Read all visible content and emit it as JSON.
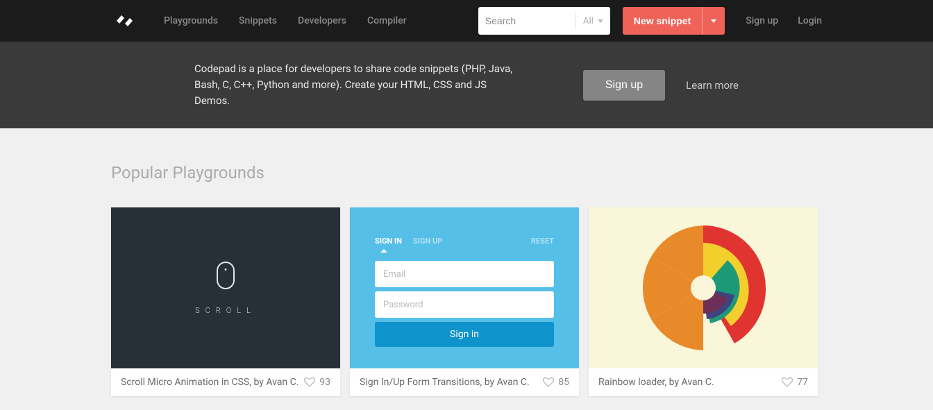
{
  "header": {
    "nav": [
      "Playgrounds",
      "Snippets",
      "Developers",
      "Compiler"
    ],
    "search_placeholder": "Search",
    "search_filter": "All",
    "new_snippet": "New snippet",
    "auth": {
      "signup": "Sign up",
      "login": "Login"
    }
  },
  "hero": {
    "text": "Codepad is a place for developers to share code snippets (PHP, Java, Bash, C, C++, Python and more). Create your HTML, CSS and JS Demos.",
    "signup": "Sign up",
    "learn_more": "Learn more"
  },
  "section_title": "Popular Playgrounds",
  "cards": [
    {
      "title": "Scroll Micro Animation in CSS, by Avan C.",
      "likes": "93",
      "preview": {
        "scroll_label": "Scroll"
      }
    },
    {
      "title": "Sign In/Up Form Transitions, by Avan C.",
      "likes": "85",
      "preview": {
        "signin": "SIGN IN",
        "signup": "SIGN UP",
        "reset": "RESET",
        "email_ph": "Email",
        "password_ph": "Password",
        "submit": "Sign in"
      }
    },
    {
      "title": "Rainbow loader, by Avan C.",
      "likes": "77"
    }
  ]
}
